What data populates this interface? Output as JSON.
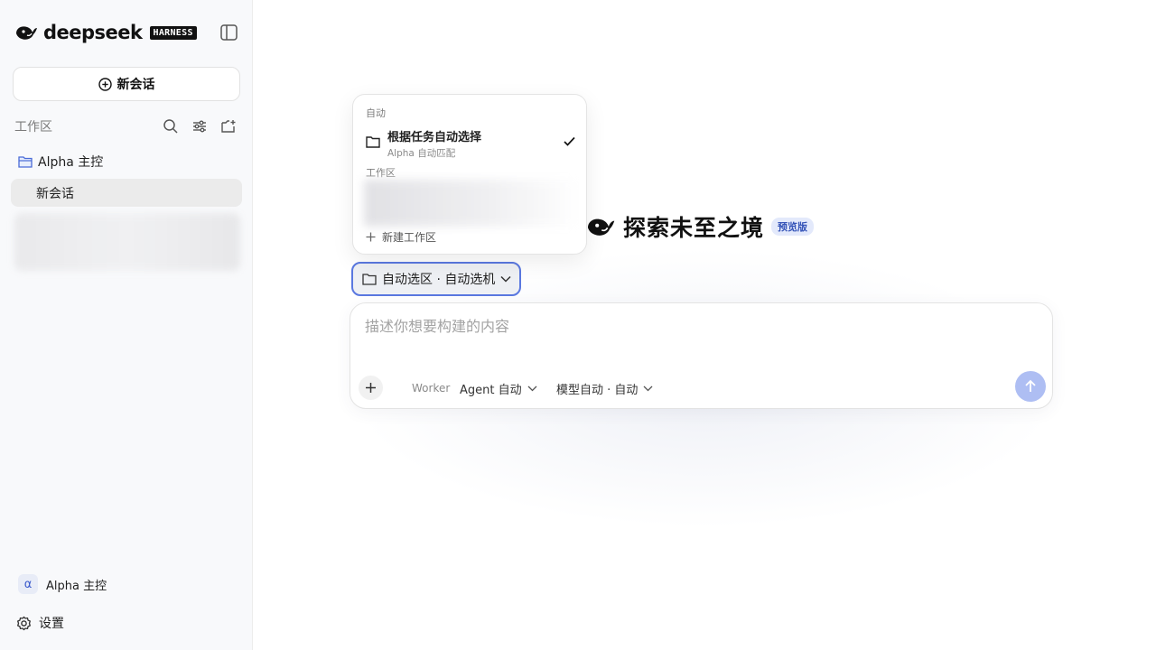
{
  "sidebar": {
    "brand": {
      "name": "deepseek",
      "badge": "HARNESS"
    },
    "new_chat_label": "新会话",
    "workspace_title": "工作区",
    "folder_label": "Alpha 主控",
    "active_chat_label": "新会话",
    "user": {
      "avatar": "α",
      "name": "Alpha 主控"
    },
    "settings_label": "设置"
  },
  "main": {
    "hero_title": "探索未至之境",
    "preview_badge": "预览版",
    "workspace_select_label": "自动选区 · 自动选机",
    "composer": {
      "placeholder": "描述你想要构建的内容",
      "worker_label": "Worker",
      "agent_label": "Agent 自动",
      "model_label": "模型自动 · 自动"
    }
  },
  "popover": {
    "auto_section": "自动",
    "auto_option_title": "根据任务自动选择",
    "auto_option_sub": "Alpha 自动匹配",
    "workspace_section": "工作区",
    "new_workspace_label": "新建工作区"
  },
  "colors": {
    "accent": "#5a78e0",
    "send_button": "#aebef3",
    "badge_bg": "#e3e9fb",
    "active_item_bg": "#ebebeb"
  },
  "icons": {
    "brand": "whale-logo-icon",
    "sidebar_toggle": "sidebar-toggle-icon",
    "new_chat": "plus-circle-icon",
    "search": "search-icon",
    "filter": "sliders-icon",
    "new_folder": "folder-plus-icon",
    "folder": "folder-icon",
    "settings": "gear-icon",
    "attach": "plus-icon",
    "send": "arrow-up-icon",
    "check": "check-icon",
    "chevron": "chevron-down-icon"
  }
}
